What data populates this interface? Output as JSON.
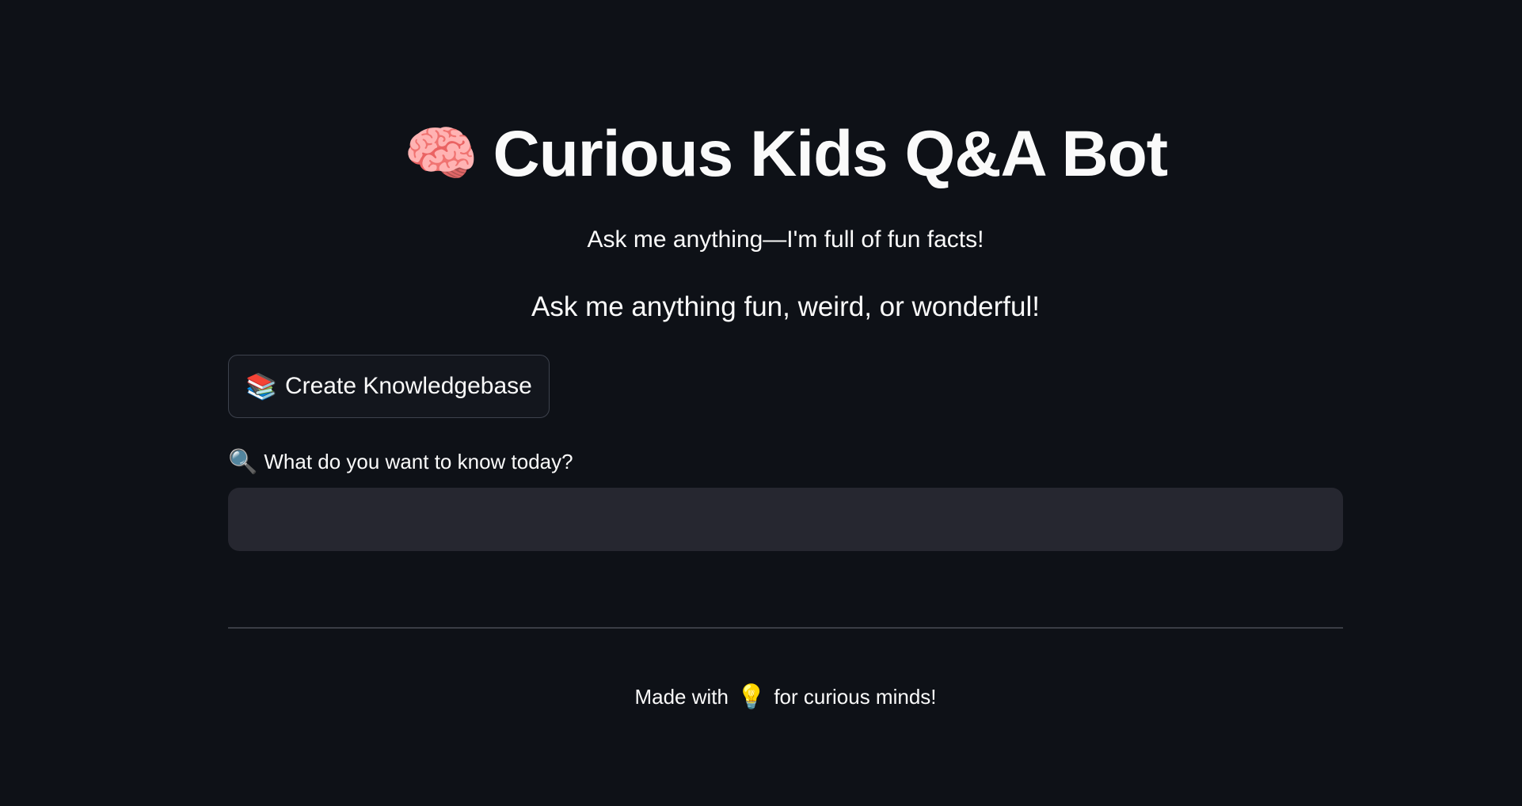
{
  "header": {
    "title_icon": "🧠",
    "title": "Curious Kids Q&A Bot",
    "subtitle": "Ask me anything—I'm full of fun facts!",
    "tagline": "Ask me anything fun, weird, or wonderful!"
  },
  "actions": {
    "kb_button_icon": "📚",
    "kb_button_label": "Create Knowledgebase"
  },
  "question": {
    "label_icon": "🔍",
    "label": "What do you want to know today?",
    "value": "",
    "placeholder": ""
  },
  "footer": {
    "prefix": "Made with",
    "icon": "💡",
    "suffix": "for curious minds!"
  },
  "colors": {
    "background": "#0e1117",
    "input_background": "#262730",
    "button_background": "#13161d",
    "button_border": "#3d424d",
    "divider": "#3a3d45",
    "text": "#fafafa"
  }
}
